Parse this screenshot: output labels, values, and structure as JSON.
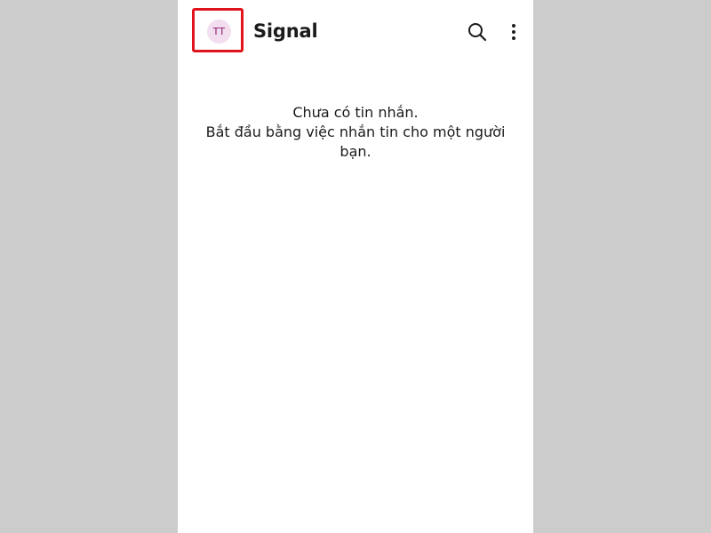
{
  "header": {
    "avatar_initials": "TT",
    "title": "Signal",
    "search_icon": "search-icon",
    "menu_icon": "more-vertical-icon"
  },
  "empty_state": {
    "line1": "Chưa có tin nhắn.",
    "line2": "Bắt đầu bằng việc nhắn tin cho một người bạn."
  },
  "colors": {
    "highlight": "#e0141c",
    "avatar_bg": "#f3def0",
    "avatar_text": "#8a1c6f",
    "backdrop": "#cccccc"
  }
}
